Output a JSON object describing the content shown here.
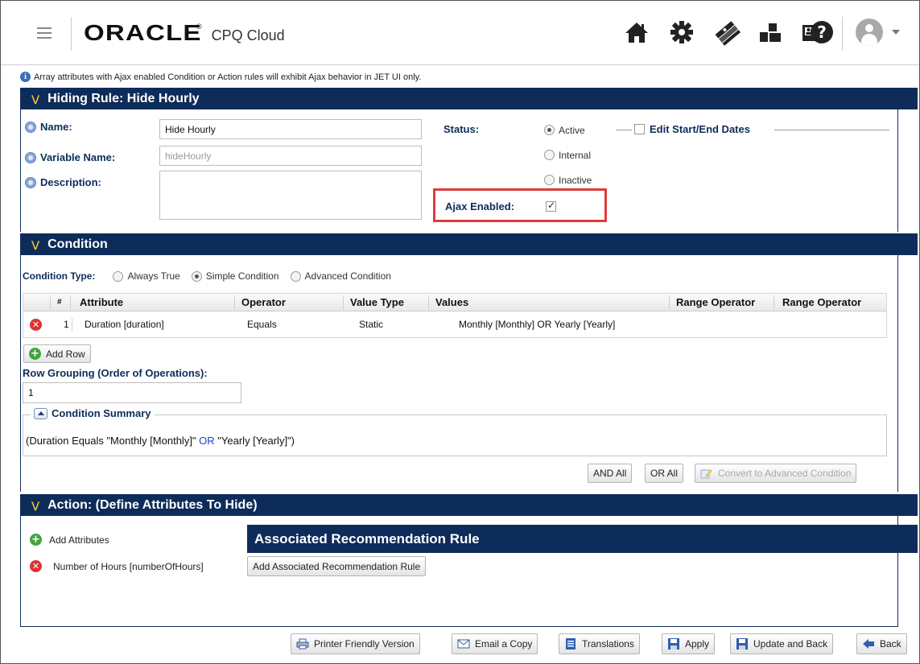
{
  "header": {
    "brand": "ORACLE",
    "brand_mark": "®",
    "product": "CPQ Cloud",
    "icons": [
      "home-icon",
      "gear-icon",
      "money-icon",
      "blocks-icon",
      "contact-card-icon",
      "help-icon"
    ]
  },
  "info": "Array attributes with Ajax enabled Condition or Action rules will exhibit Ajax behavior in JET UI only.",
  "rule": {
    "section_title": "Hiding Rule: Hide Hourly",
    "name_label": "Name:",
    "name_value": "Hide Hourly",
    "variable_label": "Variable Name:",
    "variable_value": "hideHourly",
    "description_label": "Description:",
    "description_value": "",
    "status_label": "Status:",
    "status_options": [
      "Active",
      "Internal",
      "Inactive"
    ],
    "status_selected": "Active",
    "edit_dates_label": "Edit Start/End Dates",
    "ajax_label": "Ajax Enabled:",
    "ajax_checked": true
  },
  "condition": {
    "section_title": "Condition",
    "type_label": "Condition Type:",
    "type_options": [
      "Always True",
      "Simple Condition",
      "Advanced Condition"
    ],
    "type_selected": "Simple Condition",
    "columns": [
      "#",
      "Attribute",
      "Operator",
      "Value Type",
      "Values",
      "Range Operator",
      "Range Operator"
    ],
    "rows": [
      {
        "num": "1",
        "attribute": "Duration [duration]",
        "operator": "Equals",
        "value_type": "Static",
        "values": "Monthly [Monthly] OR Yearly [Yearly]"
      }
    ],
    "add_row_label": "Add Row",
    "grouping_label": "Row Grouping (Order of Operations):",
    "grouping_value": "1",
    "summary_legend": "Condition Summary",
    "summary_part1": "(Duration Equals \"Monthly [Monthly]\"",
    "summary_or": "OR",
    "summary_part2": "\"Yearly [Yearly]\")",
    "and_all_label": "AND All",
    "or_all_label": "OR All",
    "convert_label": "Convert to Advanced Condition"
  },
  "action": {
    "section_title": "Action: (Define Attributes To Hide)",
    "add_attributes_label": "Add Attributes",
    "attribute_item": "Number of Hours [numberOfHours]",
    "assoc_title": "Associated Recommendation Rule",
    "assoc_button": "Add Associated Recommendation Rule"
  },
  "footer": {
    "printer_label": "Printer Friendly Version",
    "email_label": "Email a Copy",
    "translations_label": "Translations",
    "apply_label": "Apply",
    "update_back_label": "Update and Back",
    "back_label": "Back"
  },
  "colors": {
    "section_header": "#0d2c5a",
    "highlight_border": "#e03a3a",
    "or_text": "#1a3fd6"
  }
}
